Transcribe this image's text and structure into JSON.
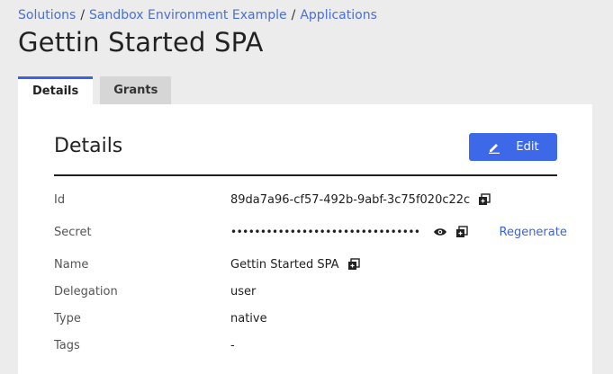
{
  "breadcrumb": {
    "items": [
      "Solutions",
      "Sandbox Environment Example",
      "Applications"
    ],
    "separator": "/"
  },
  "page_title": "Gettin Started SPA",
  "tabs": [
    {
      "label": "Details",
      "active": true
    },
    {
      "label": "Grants",
      "active": false
    }
  ],
  "details": {
    "title": "Details",
    "edit_label": "Edit",
    "edit_icon": "pencil-icon",
    "fields": {
      "id": {
        "label": "Id",
        "value": "89da7a96-cf57-492b-9abf-3c75f020c22c"
      },
      "secret": {
        "label": "Secret",
        "value": "••••••••••••••••••••••••••••••••",
        "regenerate_label": "Regenerate"
      },
      "name": {
        "label": "Name",
        "value": "Gettin Started SPA"
      },
      "delegation": {
        "label": "Delegation",
        "value": "user"
      },
      "type": {
        "label": "Type",
        "value": "native"
      },
      "tags": {
        "label": "Tags",
        "value": "-"
      }
    }
  },
  "colors": {
    "accent": "#3d68e8",
    "link": "#4a6fd8",
    "background": "#ececec",
    "panel": "#ffffff"
  }
}
